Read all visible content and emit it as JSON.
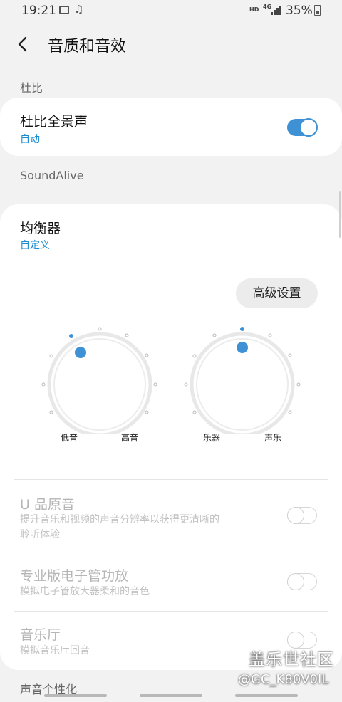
{
  "status_bar": {
    "time": "19:21",
    "network_hd": "HD",
    "network_type": "4G",
    "battery": "35%"
  },
  "app_bar": {
    "title": "音质和音效"
  },
  "dolby": {
    "section": "杜比",
    "title": "杜比全景声",
    "value": "自动",
    "enabled": true
  },
  "soundalive": {
    "section": "SoundAlive",
    "equalizer_title": "均衡器",
    "equalizer_value": "自定义",
    "advanced_button": "高级设置",
    "knob_left": {
      "left_label": "低音",
      "right_label": "高音"
    },
    "knob_right": {
      "left_label": "乐器",
      "right_label": "声乐"
    }
  },
  "options": [
    {
      "title": "U 品原音",
      "subtitle_line1": "提升音乐和视频的声音分辨率以获得更清晰的",
      "subtitle_line2": "聆听体验",
      "enabled": false
    },
    {
      "title": "专业版电子管功放",
      "subtitle_line1": "模拟电子管放大器柔和的音色",
      "enabled": false
    },
    {
      "title": "音乐厅",
      "subtitle_line1": "模拟音乐厅回音",
      "enabled": false
    }
  ],
  "next_section": "声音个性化",
  "watermark": {
    "site": "盖乐世社区",
    "user": "@GC_K80V0IL"
  },
  "colors": {
    "accent": "#3e91d5",
    "link": "#1a8ad0",
    "background": "#f2f2f2"
  }
}
